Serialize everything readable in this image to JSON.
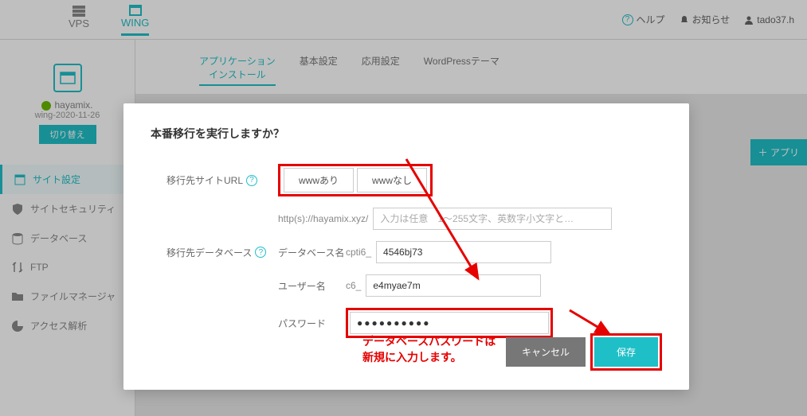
{
  "header": {
    "tab_vps": "VPS",
    "tab_wing": "WING",
    "help": "ヘルプ",
    "notice": "お知らせ",
    "user": "tado37.h"
  },
  "subtabs": {
    "install": "アプリケーション\nインストール",
    "basic": "基本設定",
    "adv": "応用設定",
    "wp": "WordPressテーマ"
  },
  "sidebar": {
    "domain": "hayamix.",
    "tag": "wing-2020-11-26",
    "swap": "切り替え",
    "items": [
      "サイト設定",
      "サイトセキュリティ",
      "データベース",
      "FTP",
      "ファイルマネージャ",
      "アクセス解析"
    ]
  },
  "add_btn": "＋ アプリ",
  "modal": {
    "title": "本番移行を実行しますか？",
    "url_label": "移行先サイトURL",
    "opt_with": "wwwあり",
    "opt_without": "wwwなし",
    "url_prefix": "http(s)://hayamix.xyz/",
    "url_placeholder": "入力は任意　1〜255文字、英数字小文字と…",
    "db_label": "移行先データベース",
    "dbname_label": "データベース名",
    "dbname_prefix": "cpti6_",
    "dbname_value": "4546bj73",
    "dbuser_label": "ユーザー名",
    "dbuser_prefix": "c6_",
    "dbuser_value": "e4myae7m",
    "pw_label": "パスワード",
    "pw_value": "●●●●●●●●●●",
    "note_line1": "データベースパスワードは",
    "note_line2": "新規に入力します。",
    "cancel": "キャンセル",
    "save": "保存"
  }
}
